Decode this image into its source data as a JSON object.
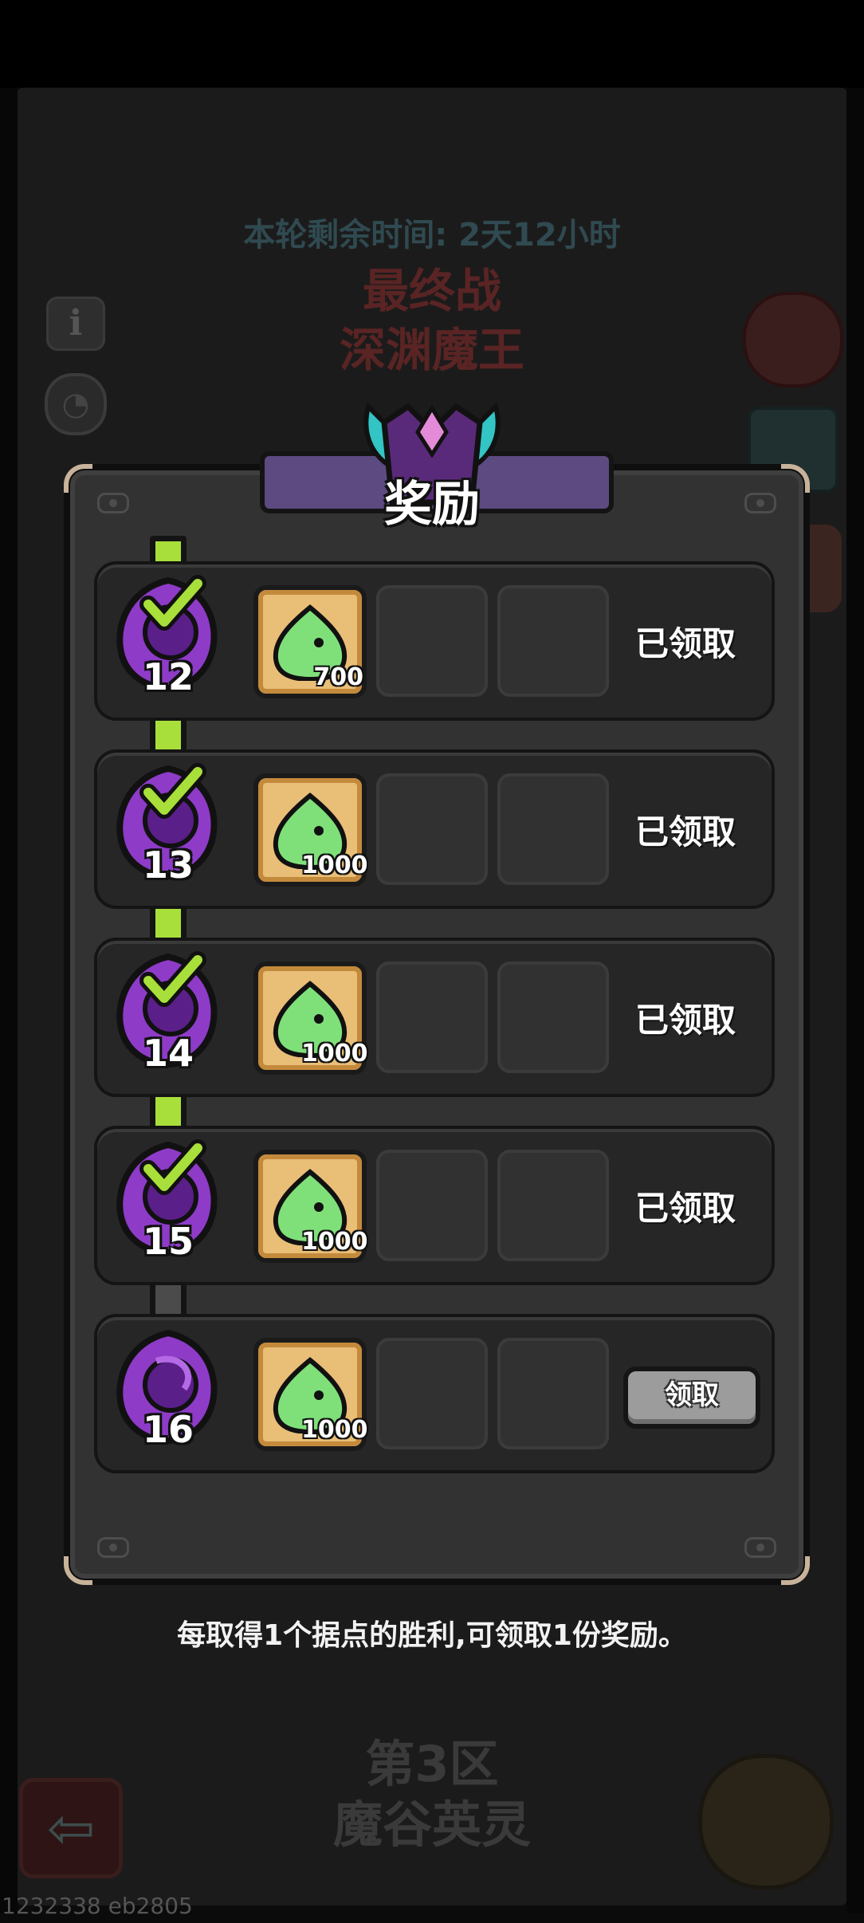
{
  "header": {
    "timer_text": "本轮剩余时间: 2天12小时",
    "title_line1": "最终战",
    "title_line2": "深渊魔王"
  },
  "dialog": {
    "title": "奖励",
    "rows": [
      {
        "level": "12",
        "item_qty": "700",
        "status": "已领取",
        "claimed": true
      },
      {
        "level": "13",
        "item_qty": "1000",
        "status": "已领取",
        "claimed": true
      },
      {
        "level": "14",
        "item_qty": "1000",
        "status": "已领取",
        "claimed": true
      },
      {
        "level": "15",
        "item_qty": "1000",
        "status": "已领取",
        "claimed": true
      },
      {
        "level": "16",
        "item_qty": "1000",
        "button_label": "领取",
        "claimed": false
      }
    ],
    "hint": "每取得1个据点的胜利,可领取1份奖励。"
  },
  "footer": {
    "zone_line1": "第3区",
    "zone_line2": "魔谷英灵"
  },
  "watermark": "1232338 eb2805",
  "colors": {
    "track_progress": "#a9df3a",
    "banner": "#5c4a80",
    "medal_purple": "#8e3bc8",
    "item_slime": "#7fe07a"
  },
  "icons": {
    "medal": "purple-swirl-medal-icon",
    "check": "check-icon",
    "item": "green-slime-icon",
    "info": "info-icon",
    "timer": "timer-icon",
    "back": "back-arrow-icon"
  }
}
